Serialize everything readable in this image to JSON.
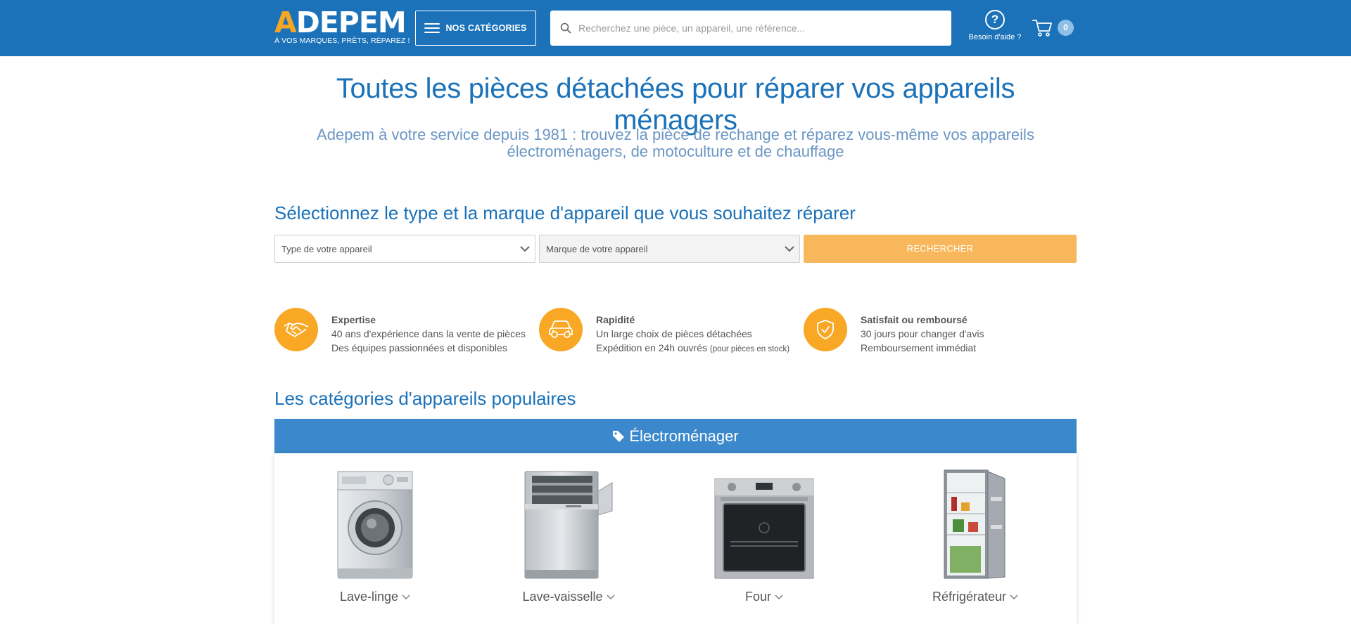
{
  "header": {
    "logo_text": "ADEPEM",
    "logo_tagline": "À VOS MARQUES, PRÊTS, RÉPAREZ !",
    "categories_button": "NOS CATÉGORIES",
    "search_placeholder": "Recherchez une pièce, un appareil, une référence...",
    "help_label": "Besoin d'aide ?",
    "cart_count": "0"
  },
  "hero": {
    "title": "Toutes les pièces détachées pour réparer vos appareils ménagers",
    "subtitle": "Adepem à votre service depuis 1981 : trouvez la pièce de rechange et réparez vous-même vos appareils électroménagers, de motoculture et de chauffage"
  },
  "selector": {
    "title": "Sélectionnez le type et la marque d'appareil que vous souhaitez réparer",
    "type_placeholder": "Type de votre appareil",
    "brand_placeholder": "Marque de votre appareil",
    "search_button": "RECHERCHER"
  },
  "features": [
    {
      "icon": "handshake-icon",
      "title": "Expertise",
      "line1": "40 ans d'expérience dans la vente de pièces",
      "line2": "Des équipes passionnées et disponibles",
      "note": ""
    },
    {
      "icon": "delivery-car-icon",
      "title": "Rapidité",
      "line1": "Un large choix de pièces détachées",
      "line2": "Expédition en 24h ouvrés",
      "note": "(pour pièces en stock)"
    },
    {
      "icon": "shield-check-icon",
      "title": "Satisfait ou remboursé",
      "line1": "30 jours pour changer d'avis",
      "line2": "Remboursement immédiat",
      "note": ""
    }
  ],
  "popular": {
    "title": "Les catégories d'appareils populaires",
    "panel_title": "Électroménager",
    "items": [
      {
        "label": "Lave-linge"
      },
      {
        "label": "Lave-vaisselle"
      },
      {
        "label": "Four"
      },
      {
        "label": "Réfrigérateur"
      }
    ]
  },
  "colors": {
    "header_blue": "#1b72b9",
    "accent_orange": "#f9a825",
    "button_orange": "#f8b75b",
    "panel_blue": "#3b89cc"
  }
}
